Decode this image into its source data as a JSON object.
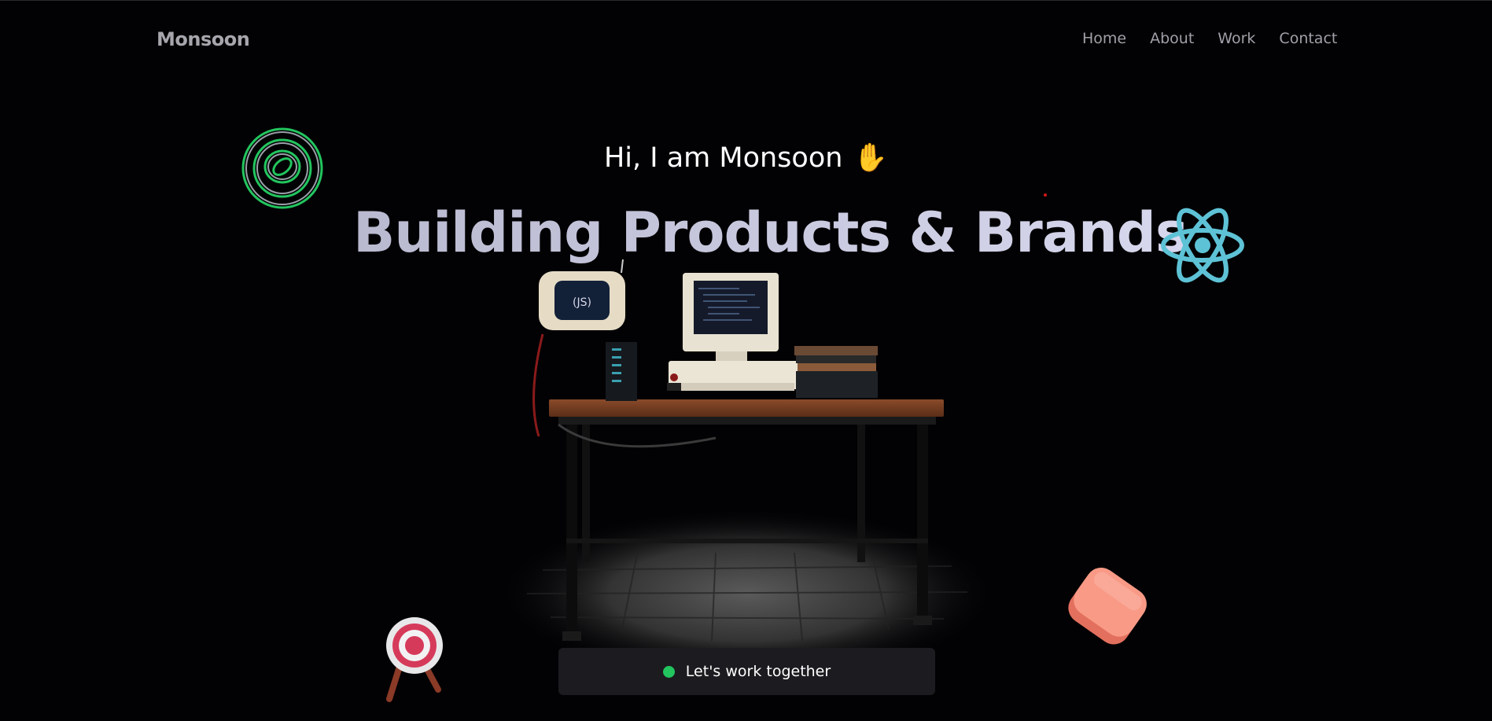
{
  "brand": {
    "name": "Monsoon"
  },
  "nav": {
    "items": [
      "Home",
      "About",
      "Work",
      "Contact"
    ]
  },
  "hero": {
    "greeting": "Hi, I am Monsoon",
    "headline": "Building Products & Brands"
  },
  "cta": {
    "label": "Let's work together",
    "status_color": "#22c55e"
  },
  "icons": {
    "spiral": "spiral-rings-icon",
    "react": "react-atom-icon",
    "target": "archery-target-icon",
    "cube": "pink-cube-icon",
    "wave": "raised-hand-icon"
  },
  "colors": {
    "background": "#020204",
    "headline": "#c8c9e0",
    "react": "#5ec2d6",
    "spiral": "#22c55e",
    "cube": "#f68b77"
  }
}
